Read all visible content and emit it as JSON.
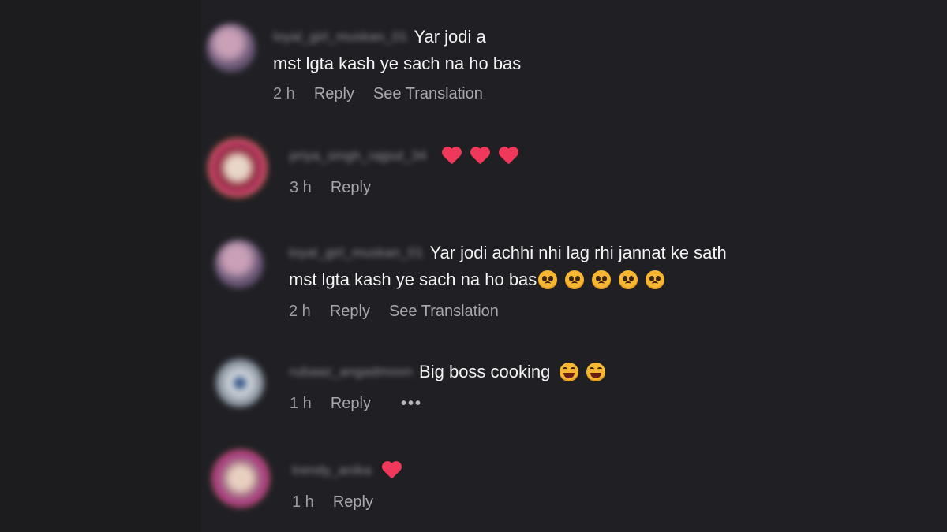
{
  "comments": [
    {
      "username": "loyal_girl_muskan_01",
      "text_line1": "Yar jodi a",
      "text_line2": "mst lgta kash ye sach na ho bas",
      "time": "2 h",
      "reply": "Reply",
      "translate": "See Translation",
      "avatar_color": "#7a6a88"
    },
    {
      "username": "priya_singh_rajput_34",
      "emojis": [
        "heart-icon",
        "heart-icon",
        "heart-icon"
      ],
      "time": "3 h",
      "reply": "Reply",
      "avatar_color": "#a0304a"
    },
    {
      "username": "loyal_girl_muskan_01",
      "text_line1": "Yar jodi achhi nhi lag rhi jannat ke sath",
      "text_line2": "mst lgta kash ye sach na ho bas",
      "emojis": [
        "pleading-face-icon",
        "pleading-face-icon",
        "pleading-face-icon",
        "pleading-face-icon",
        "pleading-face-icon"
      ],
      "time": "2 h",
      "reply": "Reply",
      "translate": "See Translation",
      "avatar_color": "#7a6a88"
    },
    {
      "username": "rubaaz_angadmoon",
      "text_line1": "Big boss cooking",
      "emojis": [
        "laughing-face-icon",
        "laughing-face-icon"
      ],
      "time": "1 h",
      "reply": "Reply",
      "more": "•••",
      "avatar_color": "#8a93a0"
    },
    {
      "username": "trendy_anika",
      "emojis": [
        "heart-icon"
      ],
      "time": "1 h",
      "reply": "Reply",
      "avatar_color": "#b07a9a"
    }
  ],
  "colors": {
    "background": "#202024",
    "text": "#f4f4f6",
    "meta": "#9c9ca3",
    "heart": "#f0385a"
  }
}
